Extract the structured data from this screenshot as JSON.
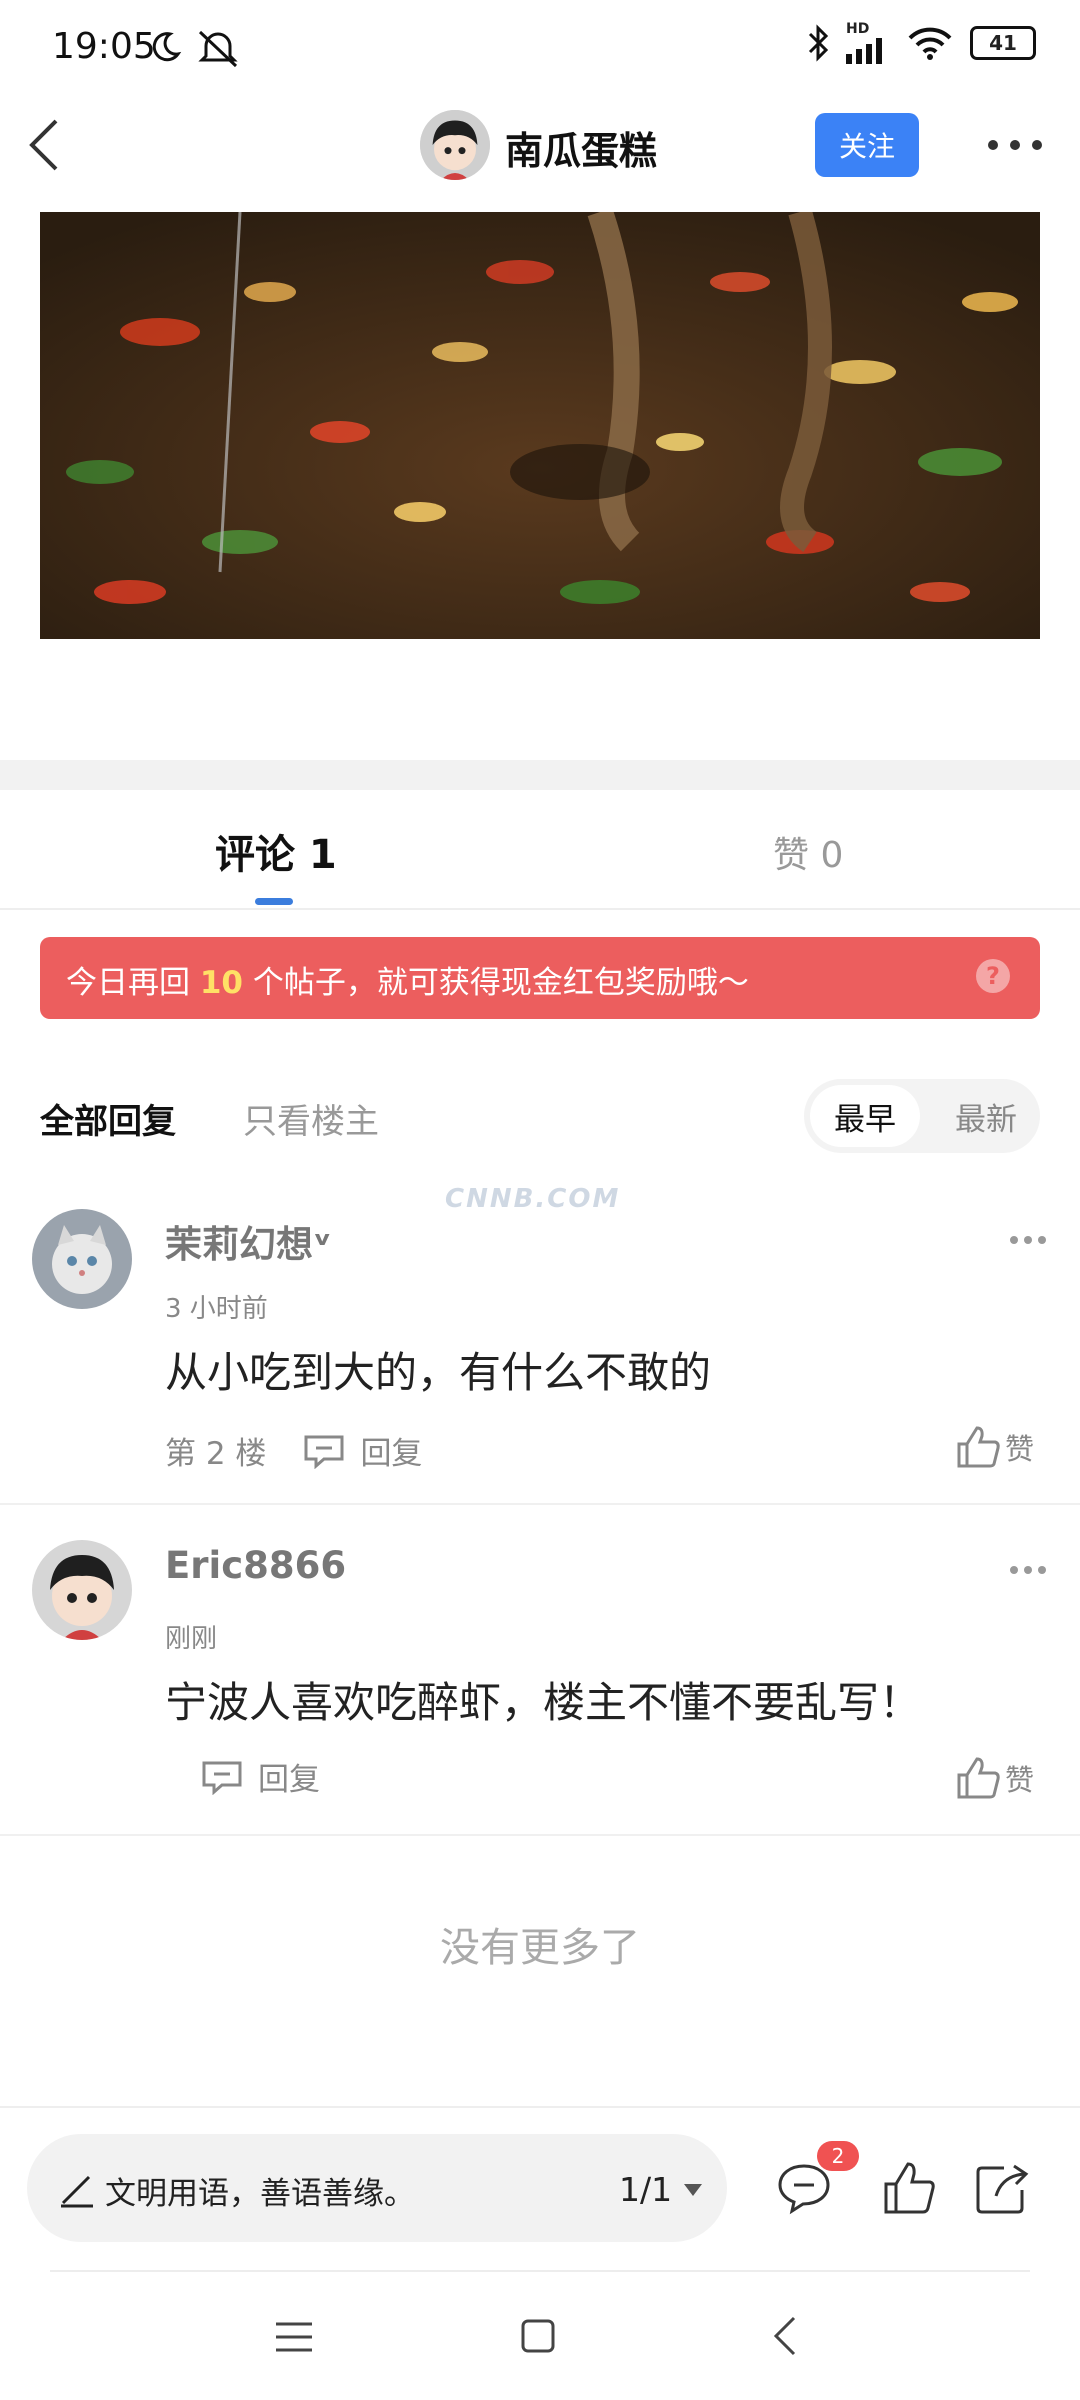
{
  "status_bar": {
    "time": "19:05",
    "battery": "41",
    "network": "HD"
  },
  "header": {
    "author": "南瓜蛋糕",
    "follow_label": "关注"
  },
  "tabs": {
    "comments": "评论 1",
    "likes": "赞 0"
  },
  "banner": {
    "prefix": "今日再回 ",
    "number": "10",
    "suffix": " 个帖子，就可获得现金红包奖励哦～",
    "help": "?"
  },
  "filters": {
    "all": "全部回复",
    "op_only": "只看楼主",
    "sort_early": "最早",
    "sort_new": "最新"
  },
  "watermark": "CNNB.COM",
  "comments": [
    {
      "name": "茉莉幻想ᵛ",
      "time": "3 小时前",
      "text": "从小吃到大的，有什么不敢的",
      "floor": "第 2 楼",
      "reply": "回复",
      "like": "赞"
    },
    {
      "name": "Eric8866",
      "time": "刚刚",
      "text": "宁波人喜欢吃醉虾，楼主不懂不要乱写！",
      "floor": "",
      "reply": "回复",
      "like": "赞"
    }
  ],
  "no_more": "没有更多了",
  "bottom_bar": {
    "placeholder": "文明用语，善语善缘。",
    "page": "1/1",
    "comment_badge": "2"
  },
  "colors": {
    "accent": "#3b82f6",
    "banner": "#ec5e5e",
    "badge": "#f05252"
  }
}
